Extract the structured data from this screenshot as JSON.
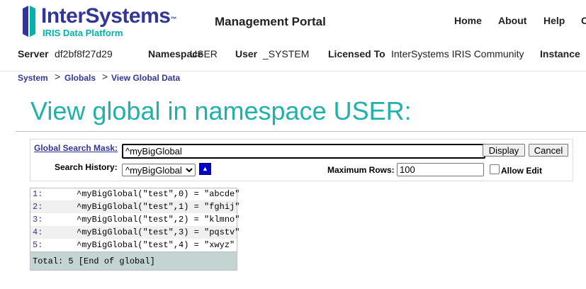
{
  "header": {
    "logo_text": "InterSystems",
    "logo_tm": "™",
    "logo_sub": "IRIS Data Platform",
    "portal_title": "Management Portal",
    "nav": [
      "Home",
      "About",
      "Help",
      "C"
    ]
  },
  "info": {
    "server_label": "Server",
    "server_value": "df2bf8f27d29",
    "namespace_label": "Namespace",
    "namespace_value": "USER",
    "user_label": "User",
    "user_value": "_SYSTEM",
    "licensed_label": "Licensed To",
    "licensed_value": "InterSystems IRIS Community",
    "instance_label": "Instance"
  },
  "breadcrumb": [
    "System",
    "Globals",
    "View Global Data"
  ],
  "page_title": "View global in namespace USER:",
  "form": {
    "mask_label": "Global Search Mask:",
    "mask_value": "^myBigGlobal",
    "display_label": "Display",
    "cancel_label": "Cancel",
    "history_label": "Search History:",
    "history_value": "^myBigGlobal",
    "max_rows_label": "Maximum Rows:",
    "max_rows_value": "100",
    "allow_edit_label": "Allow Edit",
    "allow_edit_checked": false
  },
  "results": {
    "rows": [
      {
        "num": "1:",
        "expr": "^myBigGlobal(\"test\",0) = \"abcde\""
      },
      {
        "num": "2:",
        "expr": "^myBigGlobal(\"test\",1) = \"fghij\""
      },
      {
        "num": "3:",
        "expr": "^myBigGlobal(\"test\",2) = \"klmno\""
      },
      {
        "num": "4:",
        "expr": "^myBigGlobal(\"test\",3) = \"pqstv\""
      },
      {
        "num": "5:",
        "expr": "^myBigGlobal(\"test\",4) = \"xwyz\""
      }
    ],
    "total": "Total: 5 [End of global]"
  },
  "colors": {
    "brand": "#333695",
    "accent": "#20b2aa"
  }
}
